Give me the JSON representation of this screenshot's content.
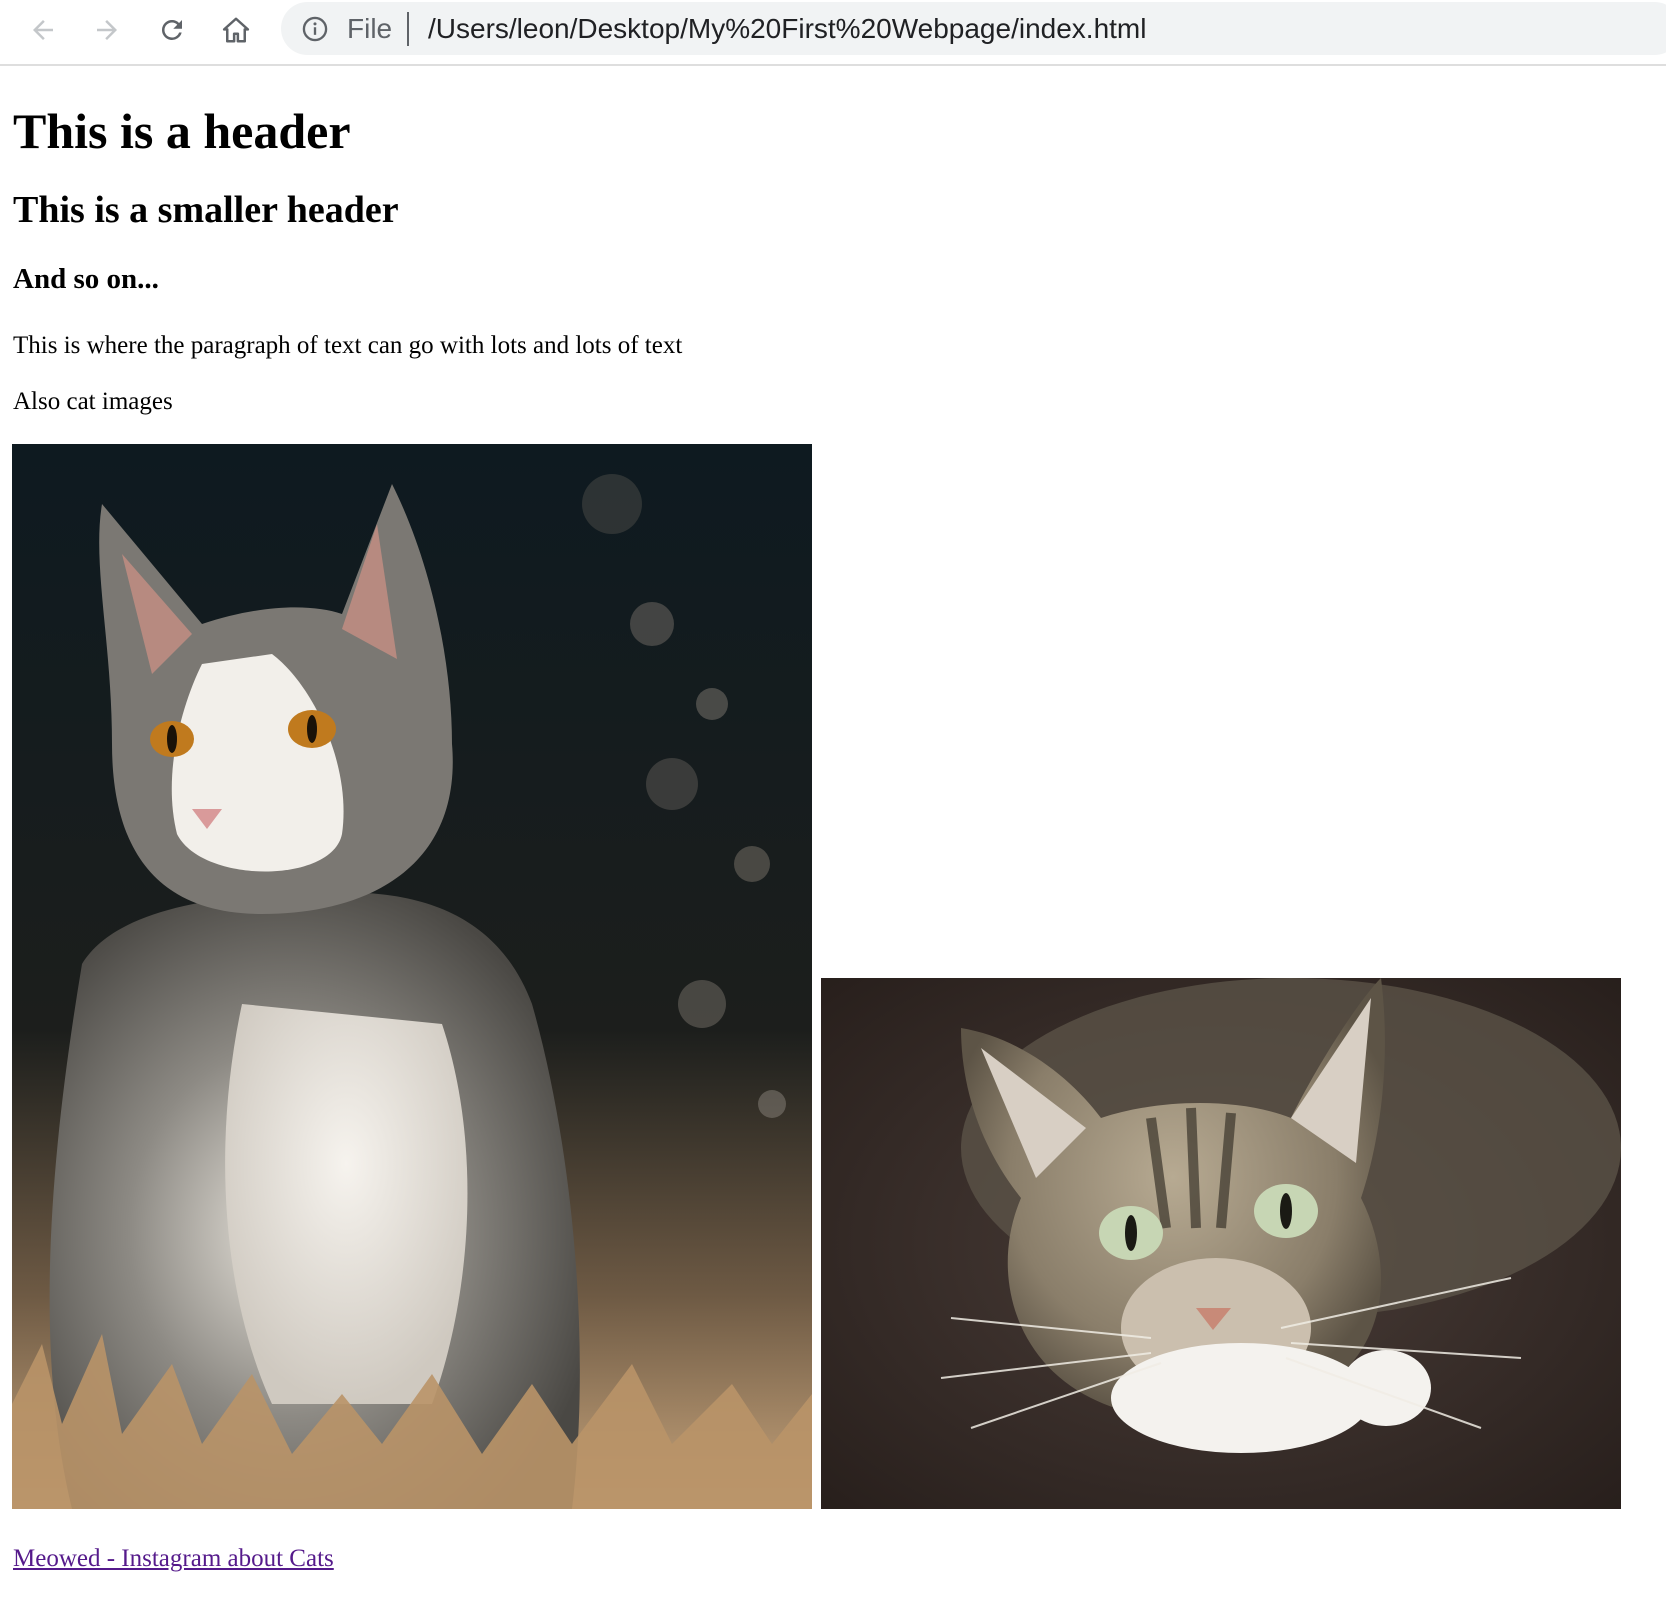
{
  "browser": {
    "address_scheme": "File",
    "address_url": "/Users/leon/Desktop/My%20First%20Webpage/index.html",
    "icons": [
      "back-icon",
      "forward-icon",
      "reload-icon",
      "home-icon",
      "info-icon"
    ]
  },
  "content": {
    "heading1": "This is a header",
    "heading2": "This is a smaller header",
    "heading3": "And so on...",
    "paragraph1": "This is where the paragraph of text can go with lots and lots of text",
    "paragraph2": "Also cat images",
    "link_text": "Meowed - Instagram about Cats"
  },
  "colors": {
    "visited_link": "#551a8b",
    "omnibox_bg": "#f1f3f4",
    "toolbar_icon": "#5f6368"
  }
}
